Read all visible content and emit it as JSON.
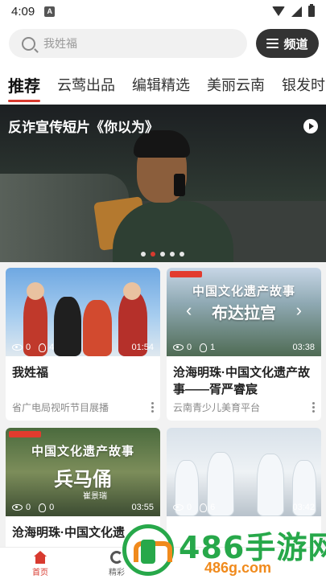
{
  "status": {
    "time": "4:09",
    "a_badge": "A"
  },
  "search": {
    "placeholder": "我姓福"
  },
  "channel": {
    "label": "频道"
  },
  "tabs": [
    {
      "label": "推荐",
      "active": true
    },
    {
      "label": "云莺出品"
    },
    {
      "label": "编辑精选"
    },
    {
      "label": "美丽云南"
    },
    {
      "label": "银发时"
    }
  ],
  "banner": {
    "title": "反诈宣传短片《你以为》",
    "dots": 5,
    "active_dot": 1
  },
  "cards": [
    {
      "title": "我姓福",
      "source": "省广电局视听节目展播",
      "views": "0",
      "likes": "4",
      "duration": "01:54",
      "thumb_caption": ""
    },
    {
      "title": "沧海明珠·中国文化遗产故事——胥严睿宸",
      "source": "云南青少儿美育平台",
      "views": "0",
      "likes": "1",
      "duration": "03:38",
      "thumb_caption": "中国文化遗产故事",
      "thumb_big": "布达拉宫"
    },
    {
      "title": "沧海明珠·中国文化遗",
      "source": "",
      "views": "0",
      "likes": "0",
      "duration": "03:55",
      "thumb_caption": "中国文化遗产故事",
      "thumb_big": "兵马俑",
      "thumb_small": "崔景瑞"
    },
    {
      "title": "",
      "source": "",
      "views": "0",
      "likes": "6",
      "duration": "03:42",
      "thumb_caption": ""
    }
  ],
  "nav": [
    {
      "label": "首页",
      "icon": "home-icon",
      "active": true
    },
    {
      "label": "精彩",
      "icon": "jing-icon"
    }
  ],
  "watermark": {
    "text": "486手游网",
    "url": "486g.com"
  }
}
